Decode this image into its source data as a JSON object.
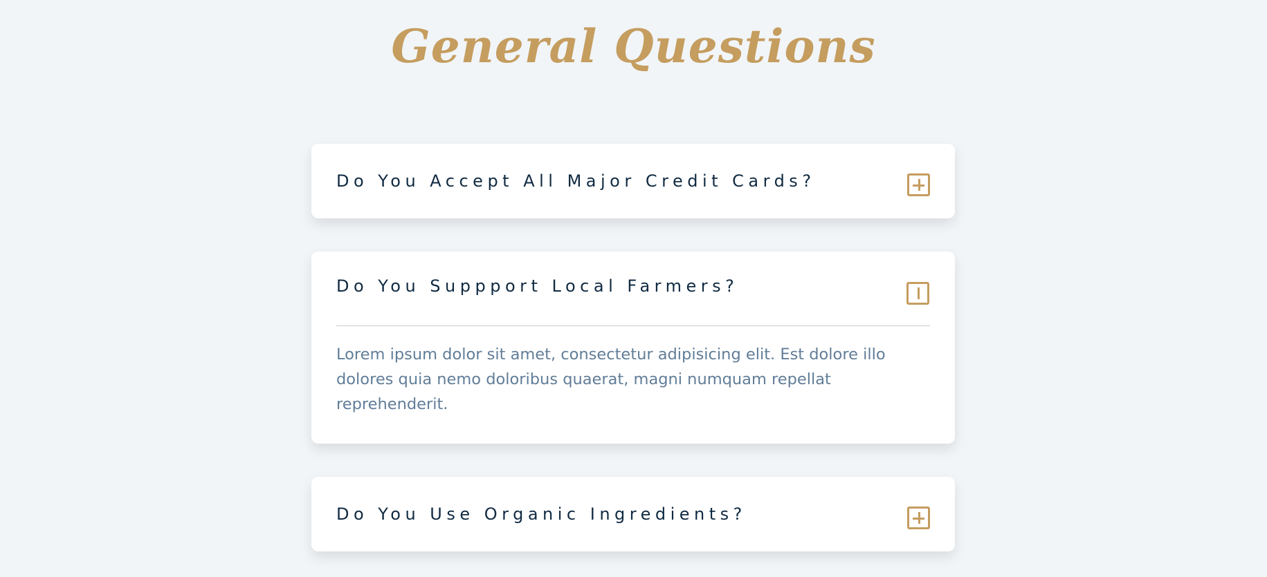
{
  "page": {
    "title": "General Questions"
  },
  "colors": {
    "background": "#f1f5f8",
    "accent": "#c59d5f",
    "question_text": "#102a42",
    "answer_text": "#617d98",
    "card": "#ffffff"
  },
  "faq": [
    {
      "question": "Do You Accept All Major Credit Cards?",
      "expanded": false,
      "toggle_icon": "plus-square-icon",
      "answer": ""
    },
    {
      "question": "Do You Suppport Local Farmers?",
      "expanded": true,
      "toggle_icon": "minus-square-icon",
      "answer": "Lorem ipsum dolor sit amet, consectetur adipisicing elit. Est dolore illo dolores quia nemo doloribus quaerat, magni numquam repellat reprehenderit."
    },
    {
      "question": "Do You Use Organic Ingredients?",
      "expanded": false,
      "toggle_icon": "plus-square-icon",
      "answer": ""
    }
  ]
}
